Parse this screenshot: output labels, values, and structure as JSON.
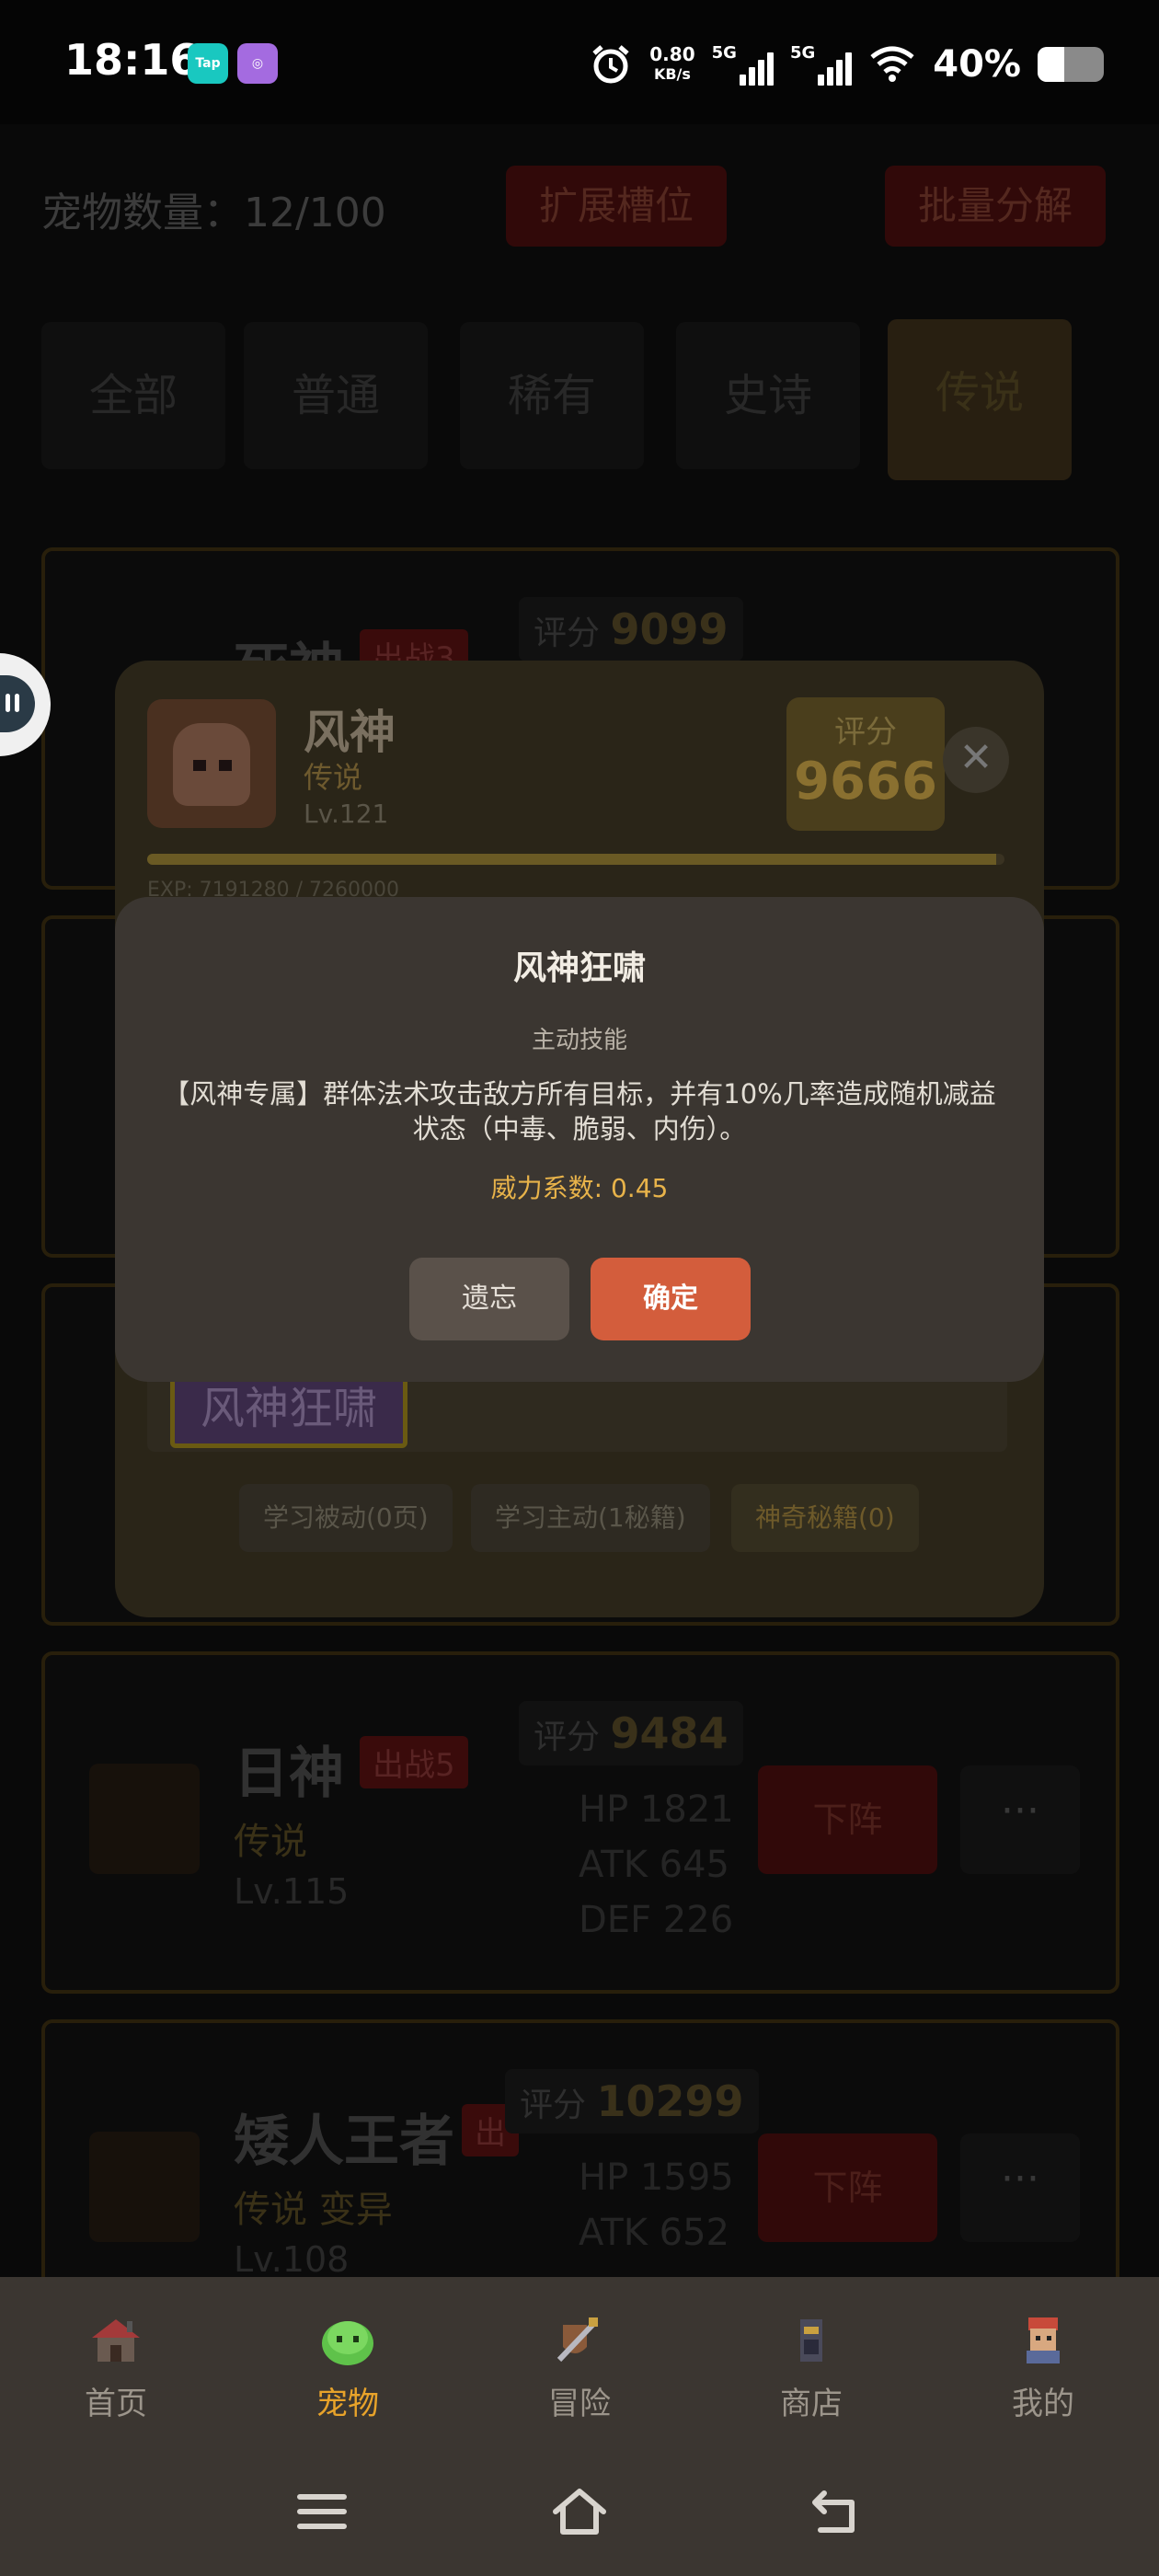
{
  "status_bar": {
    "time": "18:16",
    "app1": "Tap",
    "net_speed": "0.80",
    "net_unit": "KB/s",
    "sig1": "5G",
    "sig2": "5G",
    "battery": "40%"
  },
  "header": {
    "pet_count": "宠物数量：12/100",
    "expand_button": "扩展槽位",
    "batch_button": "批量分解"
  },
  "filters": [
    "全部",
    "普通",
    "稀有",
    "史诗",
    "传说"
  ],
  "selected_filter": "传说",
  "cards": [
    {
      "name": "死神",
      "tag": "出战3",
      "score_label": "评分",
      "score": "9099"
    },
    {
      "name": "日神",
      "tag": "出战5",
      "rarity": "传说",
      "level": "Lv.115",
      "score_label": "评分",
      "score": "9484",
      "hp": "HP 1821",
      "atk": "ATK 645",
      "def": "DEF 226",
      "action": "下阵",
      "more": "···"
    },
    {
      "name": "矮人王者",
      "tag": "出",
      "rarity": "传说 变异",
      "level": "Lv.108",
      "score_label": "评分",
      "score": "10299",
      "hp": "HP 1595",
      "atk": "ATK 652",
      "action": "下阵",
      "more": "···"
    }
  ],
  "detail": {
    "name": "风神",
    "rarity": "传说",
    "level": "Lv.121",
    "score_label": "评分",
    "score": "9666",
    "exp_text": "EXP: 7191280 / 7260000",
    "exp_fraction": 0.99,
    "skill_chip": "风神狂啸",
    "learn_passive": "学习被动(0页)",
    "learn_active": "学习主动(1秘籍)",
    "magic_book": "神奇秘籍(0)"
  },
  "dialog": {
    "title": "风神狂啸",
    "type": "主动技能",
    "description": "【风神专属】群体法术攻击敌方所有目标，并有10%几率造成随机减益状态（中毒、脆弱、内伤）。",
    "power": "威力系数: 0.45",
    "forget_button": "遗忘",
    "confirm_button": "确定"
  },
  "nav": {
    "items": [
      {
        "label": "首页",
        "icon": "house-icon"
      },
      {
        "label": "宠物",
        "icon": "slime-icon"
      },
      {
        "label": "冒险",
        "icon": "sword-shield-icon"
      },
      {
        "label": "商店",
        "icon": "shop-icon"
      },
      {
        "label": "我的",
        "icon": "player-avatar-icon"
      }
    ],
    "active": "宠物",
    "active_color": "#e8a32a"
  },
  "colors": {
    "dialog_bg": "#3b3631",
    "confirm": "#d35d3c",
    "power_text": "#e8b34a"
  }
}
